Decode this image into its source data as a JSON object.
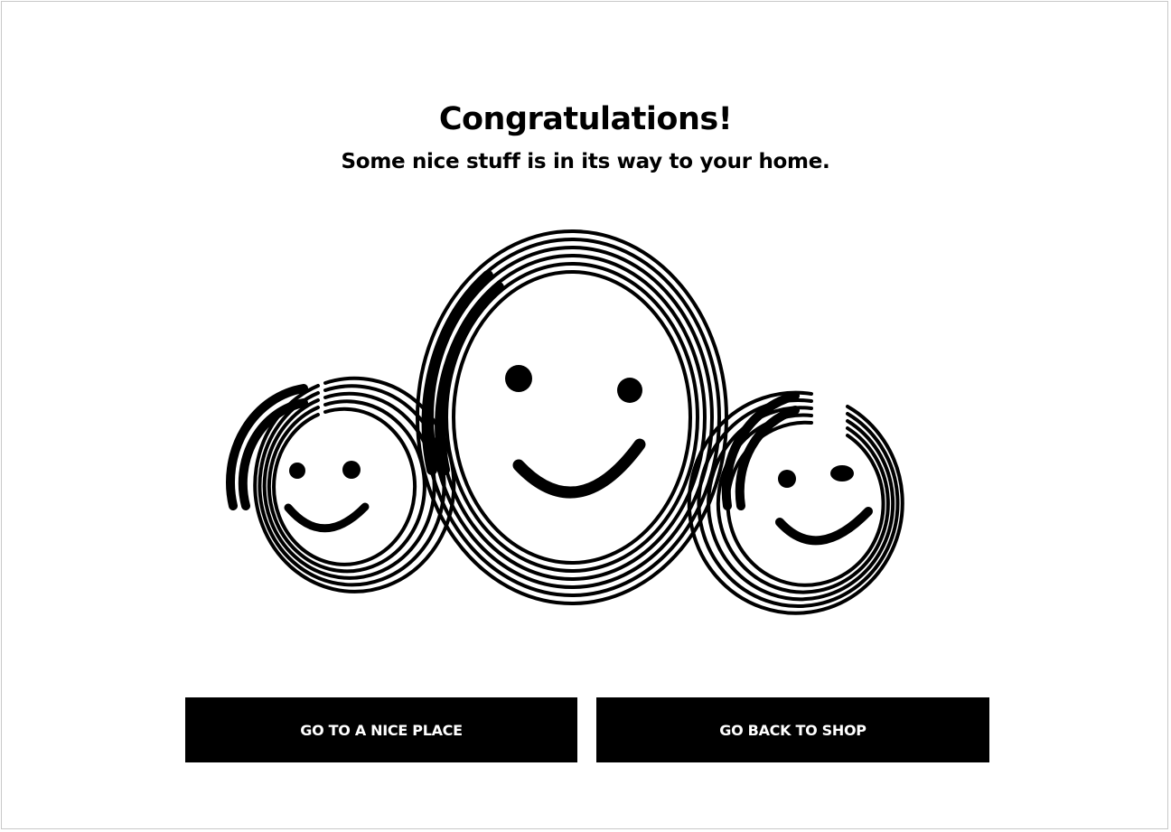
{
  "header": {
    "title": "Congratulations!",
    "subtitle": "Some nice stuff is in its way to your home."
  },
  "illustration": {
    "icon_name": "smiley-faces-icon",
    "faces": [
      "small-left-smiley-icon",
      "large-center-smiley-icon",
      "small-right-smiley-icon"
    ],
    "color": "#000000"
  },
  "actions": {
    "primary_label": "GO TO A NICE PLACE",
    "secondary_label": "GO BACK TO SHOP",
    "button_color": "#000000",
    "button_text_color": "#ffffff"
  }
}
